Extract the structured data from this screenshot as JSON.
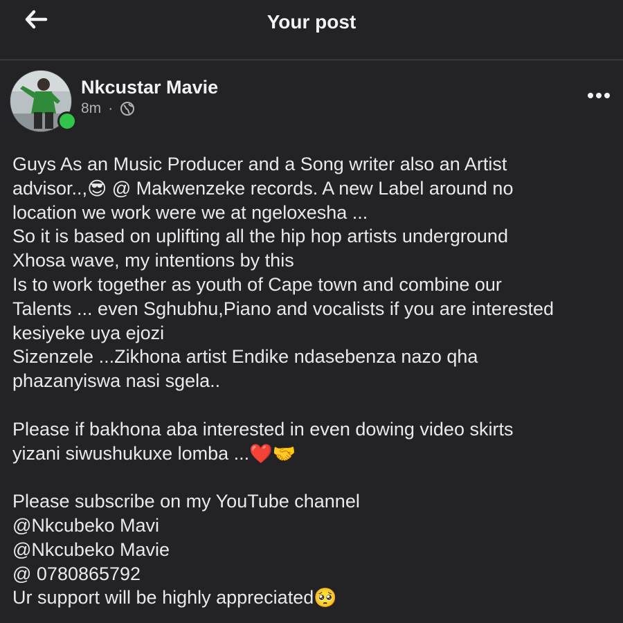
{
  "header": {
    "back_icon": "arrow-left-icon",
    "title": "Your post"
  },
  "post": {
    "author": "Nkcustar Mavie",
    "time": "8m",
    "separator": "·",
    "privacy_icon": "globe-icon",
    "online_status_color": "#31c44a",
    "more_icon": "more-horizontal-icon",
    "lines": [
      {
        "text": "Guys As an Music Producer and a Song writer also an Artist"
      },
      {
        "text": "advisor..,",
        "emoji": "😎",
        "after": " @ Makwenzeke records. A new Label around no"
      },
      {
        "text": "location we work were we at ngeloxesha ..."
      },
      {
        "text": "So it is based on uplifting all the hip hop artists underground"
      },
      {
        "text": "Xhosa wave, my intentions by this"
      },
      {
        "text": "Is to work together as youth of Cape town and combine our"
      },
      {
        "text": "Talents ... even Sghubhu,Piano and vocalists if you are interested"
      },
      {
        "text": "kesiyeke uya ejozi"
      },
      {
        "text": "Sizenzele ...Zikhona artist Endike ndasebenza nazo qha"
      },
      {
        "text": "phazanyiswa nasi sgela.."
      },
      {
        "text": ""
      },
      {
        "text": "Please if bakhona aba interested in even dowing video skirts"
      },
      {
        "text": "yizani siwushukuxe lomba ...",
        "emoji": "❤️🤝",
        "after": ""
      },
      {
        "text": ""
      },
      {
        "text": "Please subscribe on my YouTube channel"
      },
      {
        "text": "@Nkcubeko Mavi"
      },
      {
        "text": "@Nkcubeko Mavie"
      },
      {
        "text": "@ 0780865792"
      },
      {
        "text": "Ur support will be highly appreciated",
        "emoji": "🥺",
        "after": ""
      }
    ]
  },
  "colors": {
    "background": "#232325",
    "text": "#e9eaed",
    "secondary_text": "#b0b3b8",
    "divider": "#4a4b4e"
  }
}
